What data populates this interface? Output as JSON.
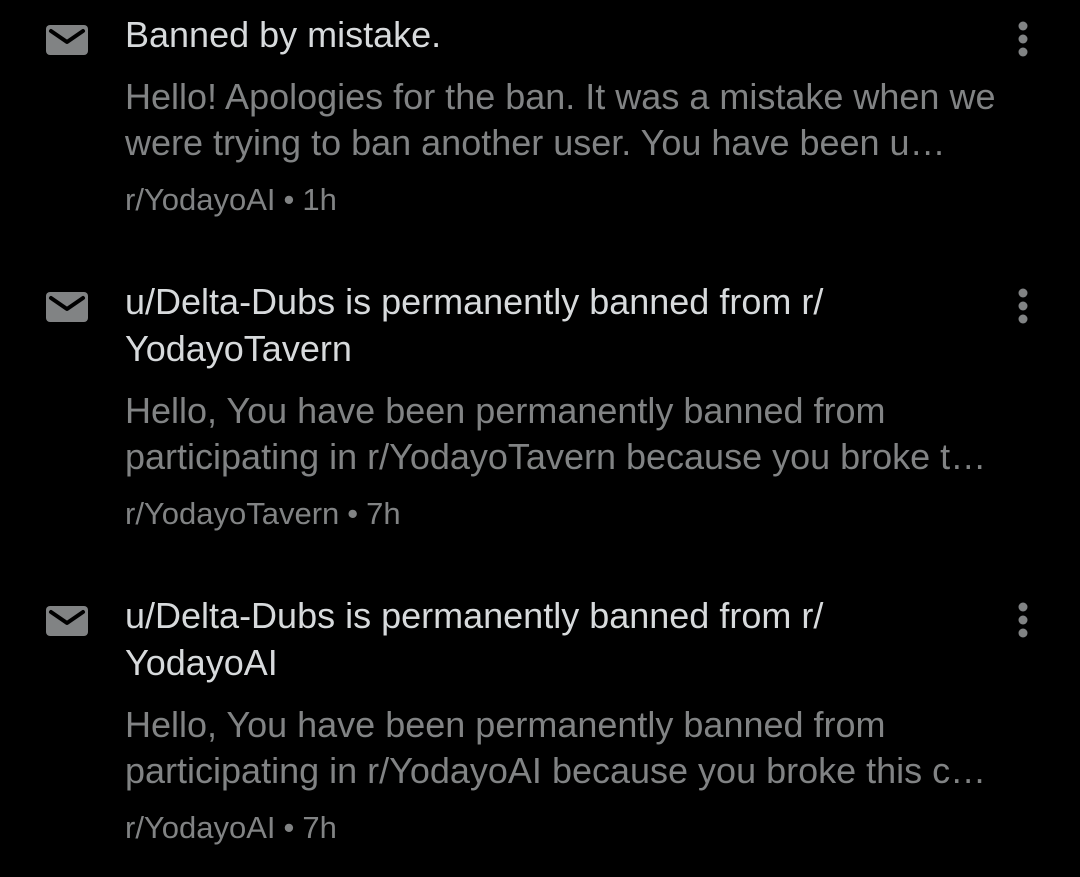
{
  "colors": {
    "background": "#000000",
    "title_text": "#d7dadc",
    "secondary_text": "#818384",
    "icon": "#818384"
  },
  "icons": {
    "message": "envelope-icon",
    "menu": "vertical-ellipsis-icon"
  },
  "messages": [
    {
      "title": "Banned by mistake.",
      "preview": "Hello! Apologies for the ban. It was a mistake when we were trying to ban another user. You have been u…",
      "source": "r/YodayoAI",
      "separator": "•",
      "time": "1h"
    },
    {
      "title": "u/Delta-Dubs is permanently banned from r/ YodayoTavern",
      "preview": "Hello, You have been permanently banned from participating in r/YodayoTavern because you broke t…",
      "source": "r/YodayoTavern",
      "separator": "•",
      "time": "7h"
    },
    {
      "title": "u/Delta-Dubs is permanently banned from r/ YodayoAI",
      "preview": "Hello, You have been permanently banned from participating in r/YodayoAI because you broke this c…",
      "source": "r/YodayoAI",
      "separator": "•",
      "time": "7h"
    }
  ]
}
